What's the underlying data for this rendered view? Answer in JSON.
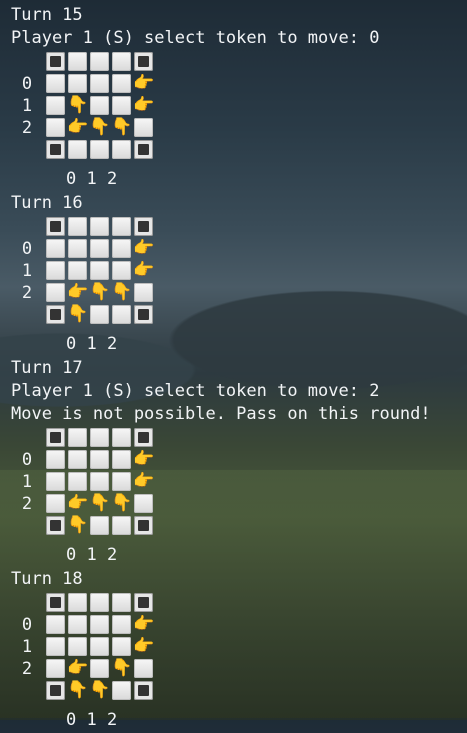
{
  "colors": {
    "cell": "#eeeeee",
    "corner": "#333333",
    "token": "#f0b419"
  },
  "icons": {
    "point_right": "backhand-index-pointing-right",
    "point_down": "backhand-index-pointing-down"
  },
  "blocks": [
    {
      "turn": "Turn 15",
      "messages": [
        "Player 1 (S) select token to move: 0"
      ],
      "rows": [
        [
          "corner",
          "cell",
          "cell",
          "cell",
          "corner"
        ],
        [
          "cell",
          "cell",
          "cell",
          "cell",
          "right"
        ],
        [
          "cell",
          "down",
          "cell",
          "cell",
          "right"
        ],
        [
          "cell",
          "right",
          "down",
          "down",
          "cell"
        ],
        [
          "corner",
          "cell",
          "cell",
          "cell",
          "corner"
        ]
      ],
      "row_labels": [
        "0",
        "1",
        "2"
      ],
      "col_labels": "0 1 2"
    },
    {
      "turn": "Turn 16",
      "messages": [],
      "rows": [
        [
          "corner",
          "cell",
          "cell",
          "cell",
          "corner"
        ],
        [
          "cell",
          "cell",
          "cell",
          "cell",
          "right"
        ],
        [
          "cell",
          "cell",
          "cell",
          "cell",
          "right"
        ],
        [
          "cell",
          "right",
          "down",
          "down",
          "cell"
        ],
        [
          "corner",
          "down",
          "cell",
          "cell",
          "corner"
        ]
      ],
      "row_labels": [
        "0",
        "1",
        "2"
      ],
      "col_labels": "0 1 2"
    },
    {
      "turn": "Turn 17",
      "messages": [
        "Player 1 (S) select token to move: 2",
        "Move is not possible. Pass on this round!"
      ],
      "rows": [
        [
          "corner",
          "cell",
          "cell",
          "cell",
          "corner"
        ],
        [
          "cell",
          "cell",
          "cell",
          "cell",
          "right"
        ],
        [
          "cell",
          "cell",
          "cell",
          "cell",
          "right"
        ],
        [
          "cell",
          "right",
          "down",
          "down",
          "cell"
        ],
        [
          "corner",
          "down",
          "cell",
          "cell",
          "corner"
        ]
      ],
      "row_labels": [
        "0",
        "1",
        "2"
      ],
      "col_labels": "0 1 2"
    },
    {
      "turn": "Turn 18",
      "messages": [],
      "rows": [
        [
          "corner",
          "cell",
          "cell",
          "cell",
          "corner"
        ],
        [
          "cell",
          "cell",
          "cell",
          "cell",
          "right"
        ],
        [
          "cell",
          "cell",
          "cell",
          "cell",
          "right"
        ],
        [
          "cell",
          "right",
          "cell",
          "down",
          "cell"
        ],
        [
          "corner",
          "down",
          "down",
          "cell",
          "corner"
        ]
      ],
      "row_labels": [
        "0",
        "1",
        "2"
      ],
      "col_labels": "0 1 2"
    }
  ]
}
